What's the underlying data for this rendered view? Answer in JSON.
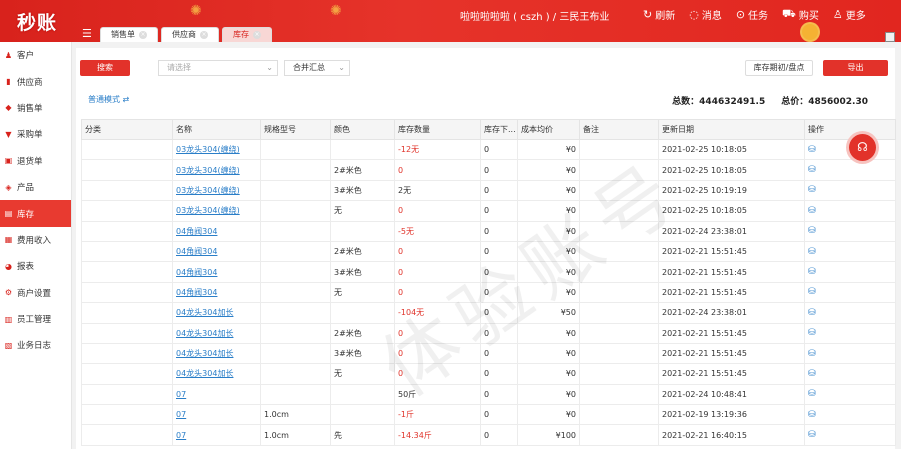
{
  "app": {
    "logo": "秒账"
  },
  "tabs": [
    {
      "label": "销售单",
      "active": false
    },
    {
      "label": "供应商",
      "active": false
    },
    {
      "label": "库存",
      "active": true
    }
  ],
  "header": {
    "user": "啦啦啦啦啦 ( cszh ) / 三民王布业",
    "actions": [
      {
        "icon": "refresh-icon",
        "glyph": "↻",
        "label": "刷新"
      },
      {
        "icon": "message-icon",
        "glyph": "◌",
        "label": "消息"
      },
      {
        "icon": "task-icon",
        "glyph": "⊙",
        "label": "任务"
      },
      {
        "icon": "cart-icon",
        "glyph": "⛟",
        "label": "购买"
      },
      {
        "icon": "user-icon",
        "glyph": "♙",
        "label": "更多"
      }
    ]
  },
  "sidebar": {
    "items": [
      {
        "label": "客户",
        "icon": "customer-icon",
        "glyph": "♟",
        "active": false
      },
      {
        "label": "供应商",
        "icon": "supplier-icon",
        "glyph": "▮",
        "active": false
      },
      {
        "label": "销售单",
        "icon": "sales-icon",
        "glyph": "◆",
        "active": false
      },
      {
        "label": "采购单",
        "icon": "purchase-icon",
        "glyph": "▼",
        "active": false
      },
      {
        "label": "退货单",
        "icon": "return-icon",
        "glyph": "▣",
        "active": false
      },
      {
        "label": "产品",
        "icon": "product-icon",
        "glyph": "◈",
        "active": false
      },
      {
        "label": "库存",
        "icon": "inventory-icon",
        "glyph": "▤",
        "active": true
      },
      {
        "label": "费用收入",
        "icon": "expense-icon",
        "glyph": "▦",
        "active": false
      },
      {
        "label": "报表",
        "icon": "report-icon",
        "glyph": "◕",
        "active": false
      },
      {
        "label": "商户设置",
        "icon": "settings-icon",
        "glyph": "⚙",
        "active": false
      },
      {
        "label": "员工管理",
        "icon": "staff-icon",
        "glyph": "▥",
        "active": false
      },
      {
        "label": "业务日志",
        "icon": "log-icon",
        "glyph": "▧",
        "active": false
      }
    ]
  },
  "toolbar": {
    "search_label": "搜索",
    "select_placeholder": "请选择",
    "merge_label": "合并汇总",
    "stock_btn": "库存期初/盘点",
    "export_btn": "导出",
    "mode_link": "普通模式 ⇄",
    "total_count": "总数：444632491.5",
    "total_price": "总价：4856002.30"
  },
  "table": {
    "headers": [
      "分类",
      "名称",
      "规格型号",
      "颜色",
      "库存数量",
      "库存下...",
      "成本均价",
      "备注",
      "更新日期",
      "操作"
    ],
    "rows": [
      {
        "category": "",
        "name": "03龙头304(缠绕)",
        "spec": "",
        "color": "",
        "qty": "-12无",
        "neg": true,
        "low": "0",
        "cost": "¥0",
        "note": "",
        "date": "2021-02-25 10:18:05"
      },
      {
        "category": "",
        "name": "03龙头304(缠绕)",
        "spec": "",
        "color": "2#米色",
        "qty": "0",
        "neg": true,
        "low": "0",
        "cost": "¥0",
        "note": "",
        "date": "2021-02-25 10:18:05"
      },
      {
        "category": "",
        "name": "03龙头304(缠绕)",
        "spec": "",
        "color": "3#米色",
        "qty": "2无",
        "neg": false,
        "low": "0",
        "cost": "¥0",
        "note": "",
        "date": "2021-02-25 10:19:19"
      },
      {
        "category": "",
        "name": "03龙头304(缠绕)",
        "spec": "",
        "color": "无",
        "qty": "0",
        "neg": true,
        "low": "0",
        "cost": "¥0",
        "note": "",
        "date": "2021-02-25 10:18:05"
      },
      {
        "category": "",
        "name": "04角阀304",
        "spec": "",
        "color": "",
        "qty": "-5无",
        "neg": true,
        "low": "0",
        "cost": "¥0",
        "note": "",
        "date": "2021-02-24 23:38:01"
      },
      {
        "category": "",
        "name": "04角阀304",
        "spec": "",
        "color": "2#米色",
        "qty": "0",
        "neg": true,
        "low": "0",
        "cost": "¥0",
        "note": "",
        "date": "2021-02-21 15:51:45"
      },
      {
        "category": "",
        "name": "04角阀304",
        "spec": "",
        "color": "3#米色",
        "qty": "0",
        "neg": true,
        "low": "0",
        "cost": "¥0",
        "note": "",
        "date": "2021-02-21 15:51:45"
      },
      {
        "category": "",
        "name": "04角阀304",
        "spec": "",
        "color": "无",
        "qty": "0",
        "neg": true,
        "low": "0",
        "cost": "¥0",
        "note": "",
        "date": "2021-02-21 15:51:45"
      },
      {
        "category": "",
        "name": "04龙头304加长",
        "spec": "",
        "color": "",
        "qty": "-104无",
        "neg": true,
        "low": "0",
        "cost": "¥50",
        "note": "",
        "date": "2021-02-24 23:38:01"
      },
      {
        "category": "",
        "name": "04龙头304加长",
        "spec": "",
        "color": "2#米色",
        "qty": "0",
        "neg": true,
        "low": "0",
        "cost": "¥0",
        "note": "",
        "date": "2021-02-21 15:51:45"
      },
      {
        "category": "",
        "name": "04龙头304加长",
        "spec": "",
        "color": "3#米色",
        "qty": "0",
        "neg": true,
        "low": "0",
        "cost": "¥0",
        "note": "",
        "date": "2021-02-21 15:51:45"
      },
      {
        "category": "",
        "name": "04龙头304加长",
        "spec": "",
        "color": "无",
        "qty": "0",
        "neg": true,
        "low": "0",
        "cost": "¥0",
        "note": "",
        "date": "2021-02-21 15:51:45"
      },
      {
        "category": "",
        "name": "07",
        "spec": "",
        "color": "",
        "qty": "50斤",
        "neg": false,
        "low": "0",
        "cost": "¥0",
        "note": "",
        "date": "2021-02-24 10:48:41"
      },
      {
        "category": "",
        "name": "07",
        "spec": "1.0cm",
        "color": "",
        "qty": "-1斤",
        "neg": true,
        "low": "0",
        "cost": "¥0",
        "note": "",
        "date": "2021-02-19 13:19:36"
      },
      {
        "category": "",
        "name": "07",
        "spec": "1.0cm",
        "color": "先",
        "qty": "-14.34斤",
        "neg": true,
        "low": "0",
        "cost": "¥100",
        "note": "",
        "date": "2021-02-21 16:40:15"
      }
    ]
  },
  "watermark": "体验账号"
}
